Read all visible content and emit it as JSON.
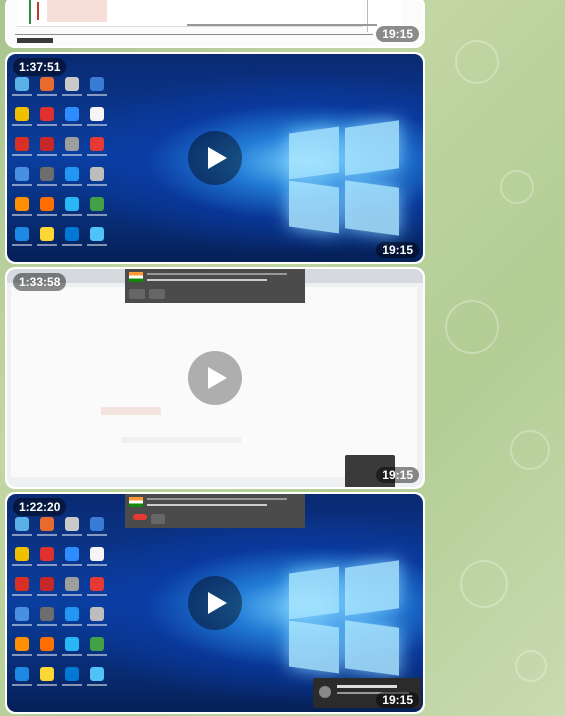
{
  "messages": [
    {
      "badge": "",
      "time": "19:15",
      "kind": "chart"
    },
    {
      "badge": "1:37:51",
      "time": "19:15",
      "kind": "desktop"
    },
    {
      "badge": "1:33:58",
      "time": "19:15",
      "kind": "browser"
    },
    {
      "badge": "1:22:20",
      "time": "19:15",
      "kind": "desktop"
    }
  ],
  "icons": {
    "play": "play-icon"
  },
  "colors": {
    "wallpaper": "#b8cf9d",
    "overlay": "rgba(0,0,0,0.45)",
    "windows_blue": "#0a3e9e"
  }
}
